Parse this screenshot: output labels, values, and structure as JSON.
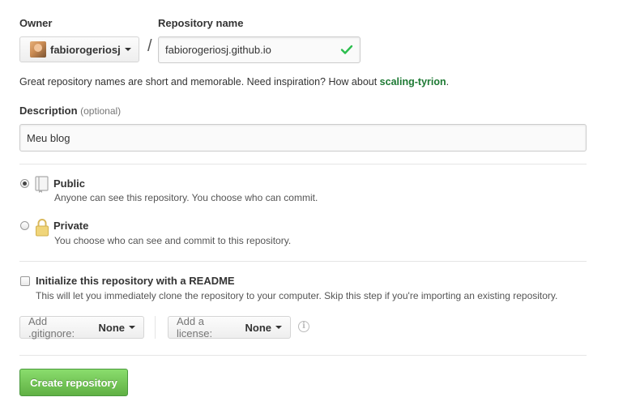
{
  "owner": {
    "label": "Owner",
    "value": "fabiorogeriosj"
  },
  "separator": "/",
  "repo_name": {
    "label": "Repository name",
    "value": "fabiorogeriosj.github.io",
    "valid": true
  },
  "name_hint": {
    "prefix": "Great repository names are short and memorable. Need inspiration? How about ",
    "suggestion": "scaling-tyrion",
    "suffix": "."
  },
  "description": {
    "label": "Description",
    "optional": "(optional)",
    "value": "Meu blog"
  },
  "visibility": {
    "selected": "public",
    "public": {
      "title": "Public",
      "desc": "Anyone can see this repository. You choose who can commit."
    },
    "private": {
      "title": "Private",
      "desc": "You choose who can see and commit to this repository."
    }
  },
  "readme": {
    "checked": false,
    "title": "Initialize this repository with a README",
    "desc": "This will let you immediately clone the repository to your computer. Skip this step if you're importing an existing repository."
  },
  "gitignore": {
    "prefix": "Add .gitignore:",
    "value": "None"
  },
  "license": {
    "prefix": "Add a license:",
    "value": "None"
  },
  "info_icon": "i",
  "create_button": "Create repository",
  "colors": {
    "accent_green": "#60b044",
    "suggestion_green": "#1e7a34",
    "check_green": "#2cbe4e"
  },
  "icons": {
    "public": "book-icon",
    "private": "lock-icon",
    "valid": "check-icon",
    "info": "info-icon"
  }
}
